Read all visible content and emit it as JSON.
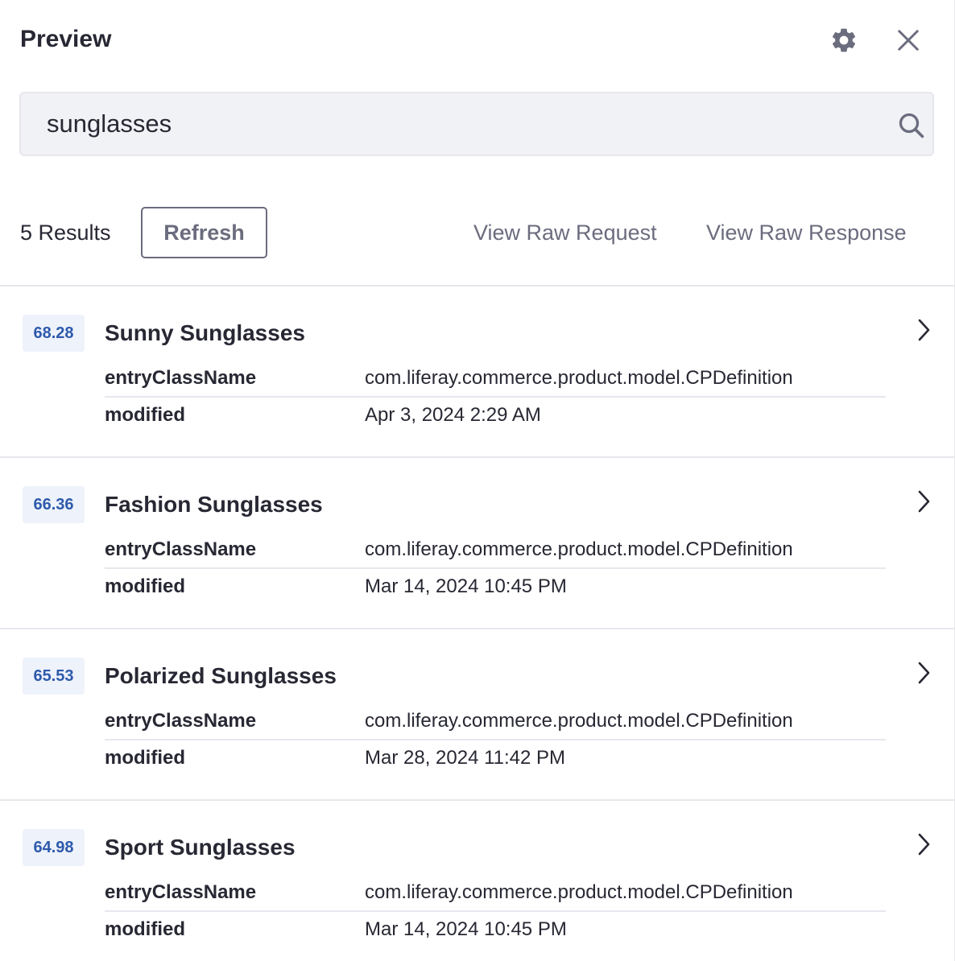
{
  "header": {
    "title": "Preview"
  },
  "search": {
    "value": "sunglasses"
  },
  "toolbar": {
    "count": "5 Results",
    "refresh_label": "Refresh",
    "raw_request_label": "View Raw Request",
    "raw_response_label": "View Raw Response"
  },
  "results": [
    {
      "score": "68.28",
      "title": "Sunny Sunglasses",
      "fields": [
        {
          "key": "entryClassName",
          "value": "com.liferay.commerce.product.model.CPDefinition"
        },
        {
          "key": "modified",
          "value": "Apr 3, 2024 2:29 AM"
        }
      ]
    },
    {
      "score": "66.36",
      "title": "Fashion Sunglasses",
      "fields": [
        {
          "key": "entryClassName",
          "value": "com.liferay.commerce.product.model.CPDefinition"
        },
        {
          "key": "modified",
          "value": "Mar 14, 2024 10:45 PM"
        }
      ]
    },
    {
      "score": "65.53",
      "title": "Polarized Sunglasses",
      "fields": [
        {
          "key": "entryClassName",
          "value": "com.liferay.commerce.product.model.CPDefinition"
        },
        {
          "key": "modified",
          "value": "Mar 28, 2024 11:42 PM"
        }
      ]
    },
    {
      "score": "64.98",
      "title": "Sport Sunglasses",
      "fields": [
        {
          "key": "entryClassName",
          "value": "com.liferay.commerce.product.model.CPDefinition"
        },
        {
          "key": "modified",
          "value": "Mar 14, 2024 10:45 PM"
        }
      ]
    }
  ],
  "icons": {
    "settings": "gear-icon",
    "close": "close-icon",
    "search": "search-icon",
    "expand": "chevron-right-icon"
  },
  "colors": {
    "text": "#272833",
    "secondary": "#6b6c7e",
    "score_text": "#2e5aac",
    "score_bg": "#eef2fa",
    "input_bg": "#f1f2f5",
    "divider": "#e7e7ed"
  }
}
